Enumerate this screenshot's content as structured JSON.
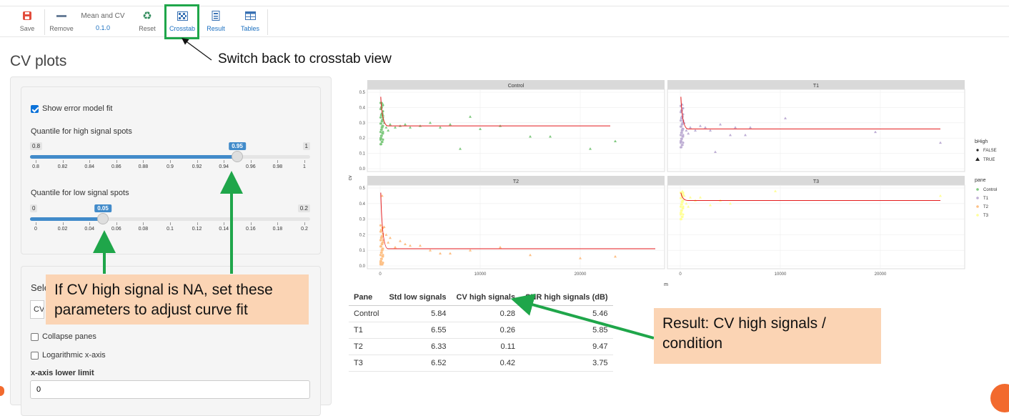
{
  "toolbar": {
    "save": "Save",
    "remove": "Remove",
    "step_name": "Mean and CV",
    "version": "0.1.0",
    "reset": "Reset",
    "crosstab": "Crosstab",
    "result": "Result",
    "tables": "Tables"
  },
  "page_title": "CV plots",
  "settings": {
    "show_error_model_fit": "Show error model fit",
    "high_label": "Quantile for high signal spots",
    "high_slider": {
      "min": 0.8,
      "max": 1,
      "value": 0.95,
      "ticks": [
        "0.8",
        "0.82",
        "0.84",
        "0.86",
        "0.88",
        "0.9",
        "0.92",
        "0.94",
        "0.96",
        "0.98",
        "1"
      ]
    },
    "low_label": "Quantile for low signal spots",
    "low_slider": {
      "min": 0,
      "max": 0.2,
      "value": 0.05,
      "ticks": [
        "0",
        "0.02",
        "0.04",
        "0.06",
        "0.08",
        "0.1",
        "0.12",
        "0.14",
        "0.16",
        "0.18",
        "0.2"
      ]
    },
    "select_label": "Sele",
    "select_value": "CV",
    "collapse_panes": "Collapse panes",
    "log_x_axis": "Logarithmic x-axis",
    "x_lower_label": "x-axis lower limit",
    "x_lower_value": "0"
  },
  "annotations": {
    "crosstab_note": "Switch back to crosstab view",
    "params_note": "If CV high signal is NA, set these parameters to adjust curve fit",
    "result_note": "Result: CV high signals / condition"
  },
  "colors": {
    "accent": "#428bca",
    "arrow": "#1fa64a",
    "callout_bg": "#fbd4b4",
    "control": "#7fc97f",
    "t1": "#beaed4",
    "t2": "#fdc086",
    "t3": "#ffff99",
    "fit_line": "#e41a1c"
  },
  "chart_data": {
    "type": "scatter",
    "xlabel": "m",
    "ylabel": "cv",
    "ylim": [
      0,
      0.5
    ],
    "yticks": [
      "0.0",
      "0.1",
      "0.2",
      "0.3",
      "0.4",
      "0.5"
    ],
    "xticks": [
      "0",
      "10000",
      "20000"
    ],
    "legend_shape_title": "bHigh",
    "legend_shape_items": [
      "FALSE",
      "TRUE"
    ],
    "legend_color_title": "pane",
    "legend_color_items": [
      "Control",
      "T1",
      "T2",
      "T3"
    ],
    "panels": [
      {
        "name": "Control",
        "fit": 0.28,
        "fit_end": 23000,
        "points": [
          [
            200,
            0.43
          ],
          [
            300,
            0.35
          ],
          [
            400,
            0.3
          ],
          [
            600,
            0.27
          ],
          [
            800,
            0.25
          ],
          [
            1000,
            0.29
          ],
          [
            1500,
            0.27
          ],
          [
            2000,
            0.28
          ],
          [
            2500,
            0.29
          ],
          [
            3000,
            0.27
          ],
          [
            4000,
            0.28
          ],
          [
            5000,
            0.3
          ],
          [
            6000,
            0.27
          ],
          [
            7000,
            0.29
          ],
          [
            9000,
            0.34
          ],
          [
            10000,
            0.26
          ],
          [
            12000,
            0.28
          ],
          [
            15000,
            0.21
          ],
          [
            17000,
            0.21
          ],
          [
            21000,
            0.13
          ],
          [
            23500,
            0.18
          ],
          [
            8000,
            0.13
          ]
        ]
      },
      {
        "name": "T1",
        "fit": 0.26,
        "fit_end": 26000,
        "points": [
          [
            200,
            0.42
          ],
          [
            400,
            0.3
          ],
          [
            600,
            0.25
          ],
          [
            800,
            0.23
          ],
          [
            1000,
            0.27
          ],
          [
            1500,
            0.25
          ],
          [
            2000,
            0.28
          ],
          [
            2500,
            0.27
          ],
          [
            3000,
            0.25
          ],
          [
            3500,
            0.11
          ],
          [
            4000,
            0.29
          ],
          [
            5000,
            0.22
          ],
          [
            5500,
            0.27
          ],
          [
            6500,
            0.22
          ],
          [
            7000,
            0.27
          ],
          [
            10500,
            0.33
          ],
          [
            19500,
            0.24
          ],
          [
            26000,
            0.17
          ]
        ]
      },
      {
        "name": "T2",
        "fit": 0.11,
        "fit_end": 27500,
        "points": [
          [
            200,
            0.45
          ],
          [
            400,
            0.25
          ],
          [
            600,
            0.2
          ],
          [
            800,
            0.15
          ],
          [
            1000,
            0.18
          ],
          [
            1500,
            0.12
          ],
          [
            2000,
            0.16
          ],
          [
            2500,
            0.14
          ],
          [
            3000,
            0.13
          ],
          [
            4000,
            0.13
          ],
          [
            5000,
            0.1
          ],
          [
            6000,
            0.08
          ],
          [
            7000,
            0.08
          ],
          [
            9000,
            0.1
          ],
          [
            12000,
            0.12
          ],
          [
            15000,
            0.07
          ],
          [
            20000,
            0.05
          ],
          [
            23500,
            0.06
          ]
        ]
      },
      {
        "name": "T3",
        "fit": 0.42,
        "fit_end": 26000,
        "points": [
          [
            200,
            0.48
          ],
          [
            400,
            0.45
          ],
          [
            600,
            0.4
          ],
          [
            800,
            0.38
          ],
          [
            1000,
            0.44
          ],
          [
            1500,
            0.42
          ],
          [
            2000,
            0.44
          ],
          [
            3000,
            0.39
          ],
          [
            4000,
            0.42
          ],
          [
            5000,
            0.4
          ],
          [
            9500,
            0.48
          ],
          [
            26000,
            0.45
          ]
        ]
      }
    ]
  },
  "results_table": {
    "headers": [
      "Pane",
      "Std low signals",
      "CV high signals",
      "SNR high signals (dB)"
    ],
    "rows": [
      [
        "Control",
        "5.84",
        "0.28",
        "5.46"
      ],
      [
        "T1",
        "6.55",
        "0.26",
        "5.85"
      ],
      [
        "T2",
        "6.33",
        "0.11",
        "9.47"
      ],
      [
        "T3",
        "6.52",
        "0.42",
        "3.75"
      ]
    ]
  }
}
